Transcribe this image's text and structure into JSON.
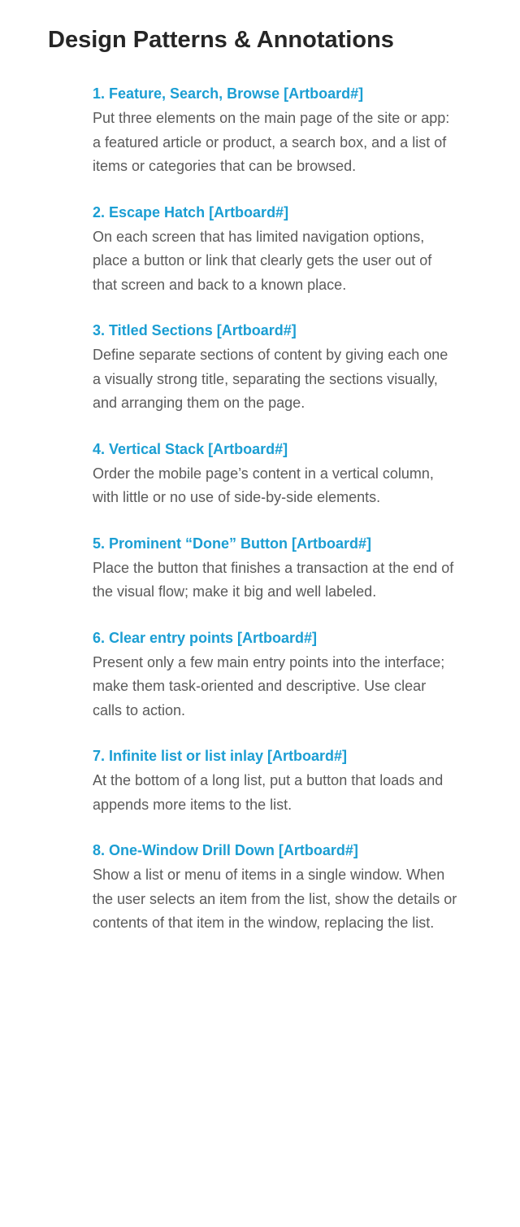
{
  "page": {
    "title": "Design Patterns & Annotations"
  },
  "patterns": [
    {
      "title": "1. Feature, Search, Browse [Artboard#]",
      "description": "Put three elements on the main page of the site or app: a featured article or product, a search box, and a list of items or categories that can be browsed."
    },
    {
      "title": "2. Escape Hatch [Artboard#]",
      "description": "On each screen that has limited navigation options, place a button or link that clearly gets the user out of that screen and back to a known place."
    },
    {
      "title": "3. Titled Sections [Artboard#]",
      "description": "Define separate sections of content by giving each one a visually strong title, separating the sections visually, and arranging them on the page."
    },
    {
      "title": "4. Vertical Stack [Artboard#]",
      "description": "Order the mobile page’s content in a vertical column, with little or no use of side-by-side elements."
    },
    {
      "title": "5. Prominent “Done” Button [Artboard#]",
      "description": "Place the button that finishes a transaction at the end of the visual flow; make it big and well labeled."
    },
    {
      "title": "6. Clear entry points [Artboard#]",
      "description": "Present only a few main entry points into the interface; make them task-oriented and descriptive. Use clear calls to action."
    },
    {
      "title": "7. Infinite list or list inlay [Artboard#]",
      "description": "At the bottom of a long list, put a button that loads and appends more items to the list."
    },
    {
      "title": "8. One-Window Drill Down [Artboard#]",
      "description": "Show a list or menu of items in a single window. When the user selects an item from the list, show the details or contents of that item in the window, replacing the list."
    }
  ],
  "colors": {
    "title_text": "#262626",
    "pattern_title": "#1b9ed3",
    "body_text": "#5a5a5a",
    "background": "#ffffff"
  }
}
